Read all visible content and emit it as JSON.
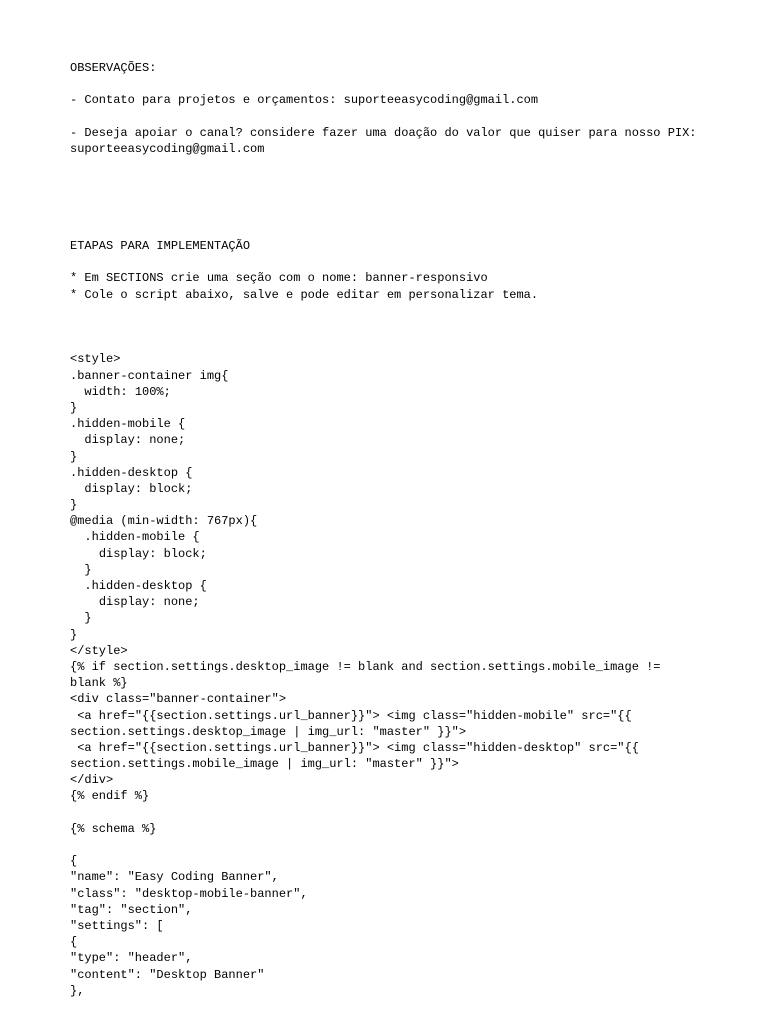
{
  "doc": {
    "heading_observacoes": "OBSERVAÇÕES:",
    "blank": "",
    "line_contact": "- Contato para projetos e orçamentos: suporteeasycoding@gmail.com",
    "line_support": "- Deseja apoiar o canal? considere fazer uma doação do valor que quiser para nosso PIX: suporteeasycoding@gmail.com",
    "heading_etapas": "ETAPAS PARA IMPLEMENTAÇÃO",
    "step1": "* Em SECTIONS crie uma seção com o nome: banner-responsivo",
    "step2": "* Cole o script abaixo, salve e pode editar em personalizar tema.",
    "code": {
      "l01": "<style>",
      "l02": ".banner-container img{",
      "l03": "  width: 100%;",
      "l04": "}",
      "l05": ".hidden-mobile {",
      "l06": "  display: none;",
      "l07": "}",
      "l08": ".hidden-desktop {",
      "l09": "  display: block;",
      "l10": "}",
      "l11": "@media (min-width: 767px){",
      "l12": "  .hidden-mobile {",
      "l13": "    display: block;",
      "l14": "  }",
      "l15": "  .hidden-desktop {",
      "l16": "    display: none;",
      "l17": "  }",
      "l18": "}",
      "l19": "</style>",
      "l20": "{% if section.settings.desktop_image != blank and section.settings.mobile_image != blank %}",
      "l21": "<div class=\"banner-container\">",
      "l22": " <a href=\"{{section.settings.url_banner}}\"> <img class=\"hidden-mobile\" src=\"{{ section.settings.desktop_image | img_url: \"master\" }}\">",
      "l23": " <a href=\"{{section.settings.url_banner}}\"> <img class=\"hidden-desktop\" src=\"{{ section.settings.mobile_image | img_url: \"master\" }}\">",
      "l24": "</div>",
      "l25": "{% endif %}",
      "l26": "{% schema %}",
      "l27": "{",
      "l28": "\"name\": \"Easy Coding Banner\",",
      "l29": "\"class\": \"desktop-mobile-banner\",",
      "l30": "\"tag\": \"section\",",
      "l31": "\"settings\": [",
      "l32": "{",
      "l33": "\"type\": \"header\",",
      "l34": "\"content\": \"Desktop Banner\"",
      "l35": "},"
    }
  }
}
